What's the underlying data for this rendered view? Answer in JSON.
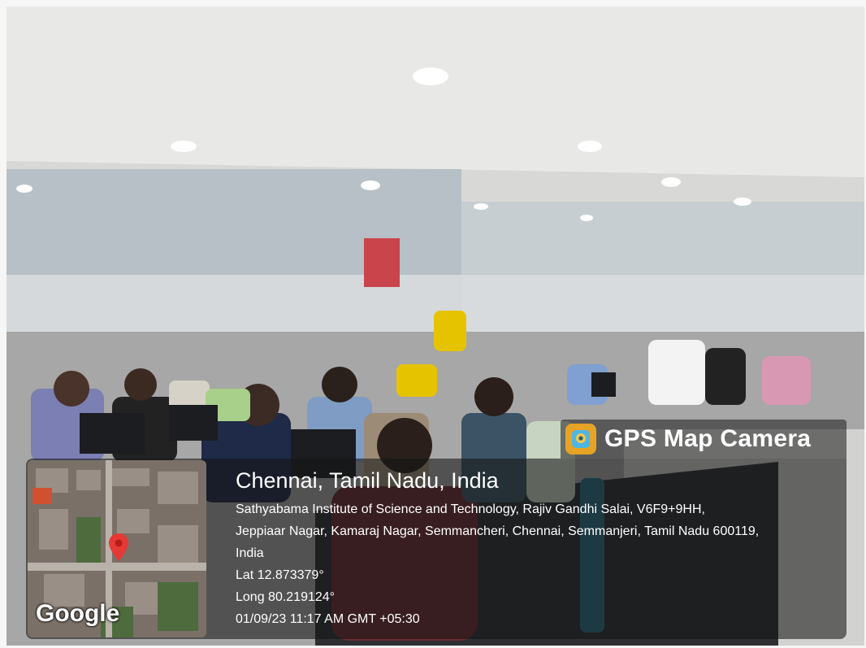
{
  "badge": {
    "label": "GPS Map Camera",
    "icon": "gps-camera-icon"
  },
  "location": {
    "title": "Chennai, Tamil Nadu, India",
    "address_lines": [
      "Sathyabama Institute of Science and Technology, Rajiv Gandhi Salai, V6F9+9HH,",
      "Jeppiaar Nagar, Kamaraj Nagar, Semmancheri, Chennai, Semmanjeri, Tamil Nadu 600119,",
      "India"
    ],
    "lat": "Lat 12.873379°",
    "long": "Long 80.219124°",
    "datetime": "01/09/23 11:17 AM GMT +05:30"
  },
  "map": {
    "logo": "Google",
    "marker_color": "#e53935",
    "marker_icon": "map-pin-icon"
  }
}
